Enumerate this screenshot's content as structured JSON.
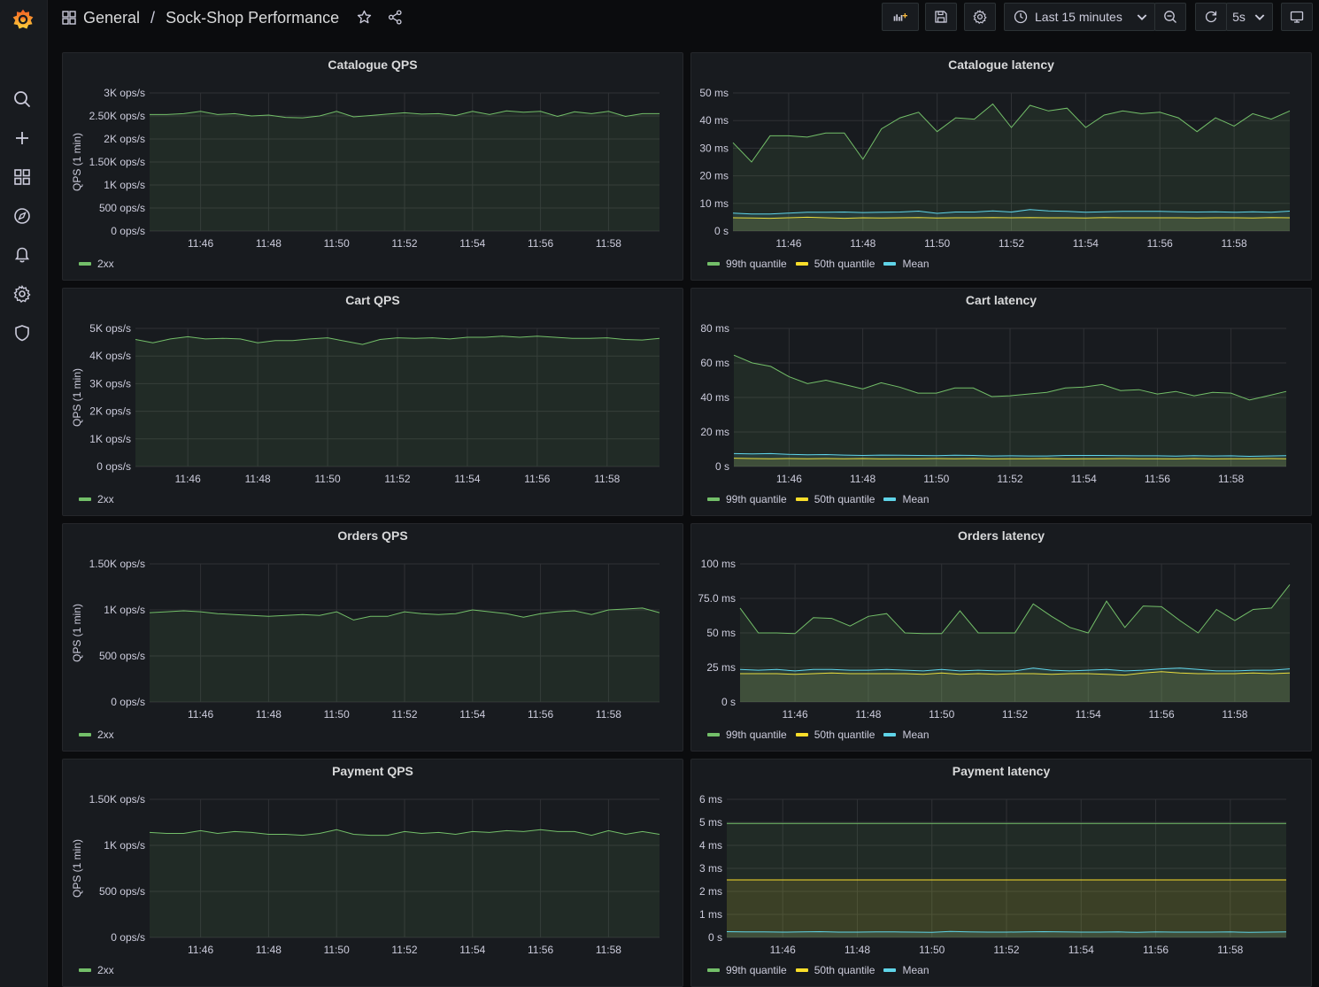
{
  "breadcrumb": {
    "folder": "General",
    "separator": "/",
    "dashboard": "Sock-Shop Performance"
  },
  "toolbar": {
    "time_range": "Last 15 minutes",
    "refresh_interval": "5s"
  },
  "icons": {
    "logo": "grafana-logo-icon",
    "sidebar": [
      "search-icon",
      "plus-icon",
      "dashboards-icon",
      "explore-icon",
      "alerting-icon",
      "configuration-icon",
      "shield-icon"
    ],
    "topbar": [
      "apps-icon",
      "star-icon",
      "share-icon",
      "add-panel-icon",
      "save-icon",
      "settings-icon",
      "clock-icon",
      "chevron-down-icon",
      "zoom-out-icon",
      "refresh-icon",
      "tv-icon"
    ]
  },
  "colors": {
    "green": "#73bf69",
    "yellow": "#fade2a",
    "blue": "#5794f2",
    "cyan": "#8ab8ff",
    "mean": "#5fd4e8"
  },
  "time_ticks": [
    "11:46",
    "11:48",
    "11:50",
    "11:52",
    "11:54",
    "11:56",
    "11:58"
  ],
  "panels": [
    {
      "id": "catalogue-qps",
      "title": "Catalogue QPS",
      "ylabel": "QPS (1 min)",
      "yticks": [
        "0 ops/s",
        "500 ops/s",
        "1K ops/s",
        "1.50K ops/s",
        "2K ops/s",
        "2.50K ops/s",
        "3K ops/s"
      ],
      "legend": [
        "2xx"
      ]
    },
    {
      "id": "catalogue-latency",
      "title": "Catalogue latency",
      "ylabel": "",
      "yticks": [
        "0 s",
        "10 ms",
        "20 ms",
        "30 ms",
        "40 ms",
        "50 ms"
      ],
      "legend": [
        "99th quantile",
        "50th quantile",
        "Mean"
      ]
    },
    {
      "id": "cart-qps",
      "title": "Cart QPS",
      "ylabel": "QPS (1 min)",
      "yticks": [
        "0 ops/s",
        "1K ops/s",
        "2K ops/s",
        "3K ops/s",
        "4K ops/s",
        "5K ops/s"
      ],
      "legend": [
        "2xx"
      ]
    },
    {
      "id": "cart-latency",
      "title": "Cart latency",
      "ylabel": "",
      "yticks": [
        "0 s",
        "20 ms",
        "40 ms",
        "60 ms",
        "80 ms"
      ],
      "legend": [
        "99th quantile",
        "50th quantile",
        "Mean"
      ]
    },
    {
      "id": "orders-qps",
      "title": "Orders QPS",
      "ylabel": "QPS (1 min)",
      "yticks": [
        "0 ops/s",
        "500 ops/s",
        "1K ops/s",
        "1.50K ops/s"
      ],
      "legend": [
        "2xx"
      ]
    },
    {
      "id": "orders-latency",
      "title": "Orders latency",
      "ylabel": "",
      "yticks": [
        "0 s",
        "25 ms",
        "50 ms",
        "75.0 ms",
        "100 ms"
      ],
      "legend": [
        "99th quantile",
        "50th quantile",
        "Mean"
      ]
    },
    {
      "id": "payment-qps",
      "title": "Payment QPS",
      "ylabel": "QPS (1 min)",
      "yticks": [
        "0 ops/s",
        "500 ops/s",
        "1K ops/s",
        "1.50K ops/s"
      ],
      "legend": [
        "2xx"
      ]
    },
    {
      "id": "payment-latency",
      "title": "Payment latency",
      "ylabel": "",
      "yticks": [
        "0 s",
        "1 ms",
        "2 ms",
        "3 ms",
        "4 ms",
        "5 ms",
        "6 ms"
      ],
      "legend": [
        "99th quantile",
        "50th quantile",
        "Mean"
      ]
    }
  ],
  "chart_data": [
    {
      "type": "area",
      "title": "Catalogue QPS",
      "ylabel": "QPS (1 min)",
      "ylim": [
        0,
        3000
      ],
      "unit": "ops/s",
      "x": [
        "11:45",
        "11:45:30",
        "11:46",
        "11:46:30",
        "11:47",
        "11:47:30",
        "11:48",
        "11:48:30",
        "11:49",
        "11:49:30",
        "11:50",
        "11:50:30",
        "11:51",
        "11:51:30",
        "11:52",
        "11:52:30",
        "11:53",
        "11:53:30",
        "11:54",
        "11:54:30",
        "11:55",
        "11:55:30",
        "11:56",
        "11:56:30",
        "11:57",
        "11:57:30",
        "11:58",
        "11:58:30",
        "11:59",
        "11:59:30"
      ],
      "series": [
        {
          "name": "2xx",
          "color": "#73bf69",
          "values": [
            2530,
            2530,
            2550,
            2600,
            2530,
            2550,
            2500,
            2520,
            2470,
            2460,
            2500,
            2600,
            2480,
            2510,
            2540,
            2570,
            2540,
            2550,
            2510,
            2600,
            2530,
            2610,
            2580,
            2600,
            2490,
            2590,
            2550,
            2600,
            2490,
            2550,
            2550
          ]
        }
      ]
    },
    {
      "type": "area",
      "title": "Catalogue latency",
      "ylim": [
        0,
        50
      ],
      "unit": "ms",
      "series": [
        {
          "name": "99th quantile",
          "color": "#73bf69",
          "values": [
            32,
            25,
            34.5,
            34.5,
            34,
            35.5,
            35.5,
            26,
            37,
            41,
            43,
            36,
            41,
            40.5,
            46,
            37.5,
            45.5,
            43.5,
            44.5,
            37.5,
            42,
            43.5,
            42.5,
            43,
            41,
            36,
            41,
            38,
            42.5,
            40.5,
            43.5
          ]
        },
        {
          "name": "50th quantile",
          "color": "#fade2a",
          "values": [
            4.8,
            4.7,
            4.6,
            4.8,
            5,
            4.8,
            4.6,
            4.8,
            4.7,
            4.8,
            4.9,
            4.7,
            4.8,
            4.8,
            4.9,
            4.8,
            4.9,
            4.8,
            4.8,
            4.7,
            4.9,
            4.8,
            4.8,
            4.8,
            4.8,
            4.7,
            4.8,
            4.8,
            4.7,
            4.9,
            4.8
          ]
        },
        {
          "name": "Mean",
          "color": "#5fd4e8",
          "values": [
            6.5,
            6.2,
            6.2,
            6.5,
            6.8,
            6.8,
            6.9,
            6.7,
            6.8,
            6.9,
            7.2,
            6.4,
            6.9,
            6.9,
            7.3,
            6.9,
            7.8,
            7.3,
            7.1,
            6.8,
            7.0,
            7.1,
            7.1,
            7.1,
            7.0,
            6.9,
            7.0,
            6.8,
            7.0,
            6.8,
            7.2
          ]
        }
      ]
    },
    {
      "type": "area",
      "title": "Cart QPS",
      "ylabel": "QPS (1 min)",
      "ylim": [
        0,
        5000
      ],
      "unit": "ops/s",
      "series": [
        {
          "name": "2xx",
          "color": "#73bf69",
          "values": [
            4600,
            4480,
            4620,
            4700,
            4620,
            4640,
            4620,
            4480,
            4560,
            4560,
            4620,
            4660,
            4540,
            4420,
            4600,
            4660,
            4640,
            4660,
            4620,
            4680,
            4680,
            4720,
            4680,
            4720,
            4680,
            4640,
            4640,
            4660,
            4600,
            4580,
            4640
          ]
        }
      ]
    },
    {
      "type": "area",
      "title": "Cart latency",
      "ylim": [
        0,
        80
      ],
      "unit": "ms",
      "series": [
        {
          "name": "99th quantile",
          "color": "#73bf69",
          "values": [
            64.5,
            60,
            58,
            52,
            48,
            50,
            47.5,
            45,
            48.5,
            46,
            42.5,
            42.5,
            45.5,
            45.5,
            40.5,
            41,
            42,
            43,
            45.5,
            46,
            47.5,
            44,
            44.5,
            42,
            43.5,
            41,
            43,
            42.5,
            38.5,
            41,
            43.5
          ]
        },
        {
          "name": "50th quantile",
          "color": "#fade2a",
          "values": [
            4.8,
            4.6,
            4.5,
            4.6,
            4.5,
            4.6,
            4.5,
            4.6,
            4.4,
            4.5,
            4.5,
            4.6,
            4.5,
            4.6,
            4.4,
            4.5,
            4.5,
            4.6,
            4.4,
            4.5,
            4.5,
            4.6,
            4.5,
            4.5,
            4.4,
            4.6,
            4.4,
            4.5,
            4.5,
            4.6,
            4.5
          ]
        },
        {
          "name": "Mean",
          "color": "#5fd4e8",
          "values": [
            7.5,
            7.3,
            7.5,
            7.0,
            6.8,
            6.9,
            6.6,
            6.4,
            6.6,
            6.5,
            6.4,
            6.3,
            6.5,
            6.4,
            6.1,
            6.2,
            6.1,
            6.1,
            6.4,
            6.4,
            6.4,
            6.3,
            6.2,
            6.2,
            6.0,
            6.3,
            6.1,
            6.2,
            5.9,
            6.1,
            6.3
          ]
        }
      ]
    },
    {
      "type": "area",
      "title": "Orders QPS",
      "ylabel": "QPS (1 min)",
      "ylim": [
        0,
        1500
      ],
      "unit": "ops/s",
      "series": [
        {
          "name": "2xx",
          "color": "#73bf69",
          "values": [
            970,
            980,
            990,
            980,
            960,
            950,
            940,
            930,
            940,
            950,
            940,
            980,
            890,
            930,
            930,
            980,
            960,
            950,
            960,
            1000,
            980,
            960,
            920,
            960,
            980,
            990,
            950,
            1000,
            1010,
            1020,
            970
          ]
        }
      ]
    },
    {
      "type": "area",
      "title": "Orders latency",
      "ylim": [
        0,
        100
      ],
      "unit": "ms",
      "series": [
        {
          "name": "99th quantile",
          "color": "#73bf69",
          "values": [
            68,
            50,
            50,
            49.5,
            61,
            60.5,
            55,
            62,
            64,
            50,
            49.5,
            49.5,
            66,
            50,
            50,
            50,
            71,
            62,
            54,
            50,
            73,
            54,
            69.5,
            69,
            59,
            50,
            67,
            59,
            67,
            68,
            85
          ]
        },
        {
          "name": "50th quantile",
          "color": "#fade2a",
          "values": [
            20.5,
            20.5,
            20.5,
            20,
            20.5,
            21,
            20.5,
            20.5,
            20.5,
            20.5,
            20,
            21,
            20,
            20.5,
            20,
            20.5,
            20.5,
            20,
            20.5,
            20.5,
            20,
            19.5,
            21,
            22,
            21,
            20.5,
            20.5,
            20.5,
            21,
            20.5,
            21
          ]
        },
        {
          "name": "Mean",
          "color": "#5fd4e8",
          "values": [
            23.5,
            23,
            23.5,
            22.5,
            23.5,
            23.5,
            23,
            23,
            23.5,
            23,
            22.5,
            23.5,
            22.5,
            23,
            22.5,
            22.5,
            24.5,
            23,
            22.5,
            23,
            23.5,
            22.5,
            23,
            24,
            24.5,
            23.5,
            22.5,
            22.5,
            23,
            23,
            24
          ]
        }
      ]
    },
    {
      "type": "area",
      "title": "Payment QPS",
      "ylabel": "QPS (1 min)",
      "ylim": [
        0,
        1500
      ],
      "unit": "ops/s",
      "series": [
        {
          "name": "2xx",
          "color": "#73bf69",
          "values": [
            1140,
            1130,
            1130,
            1160,
            1130,
            1150,
            1140,
            1120,
            1120,
            1110,
            1130,
            1170,
            1120,
            1110,
            1110,
            1150,
            1130,
            1140,
            1120,
            1150,
            1140,
            1160,
            1150,
            1170,
            1150,
            1150,
            1110,
            1160,
            1120,
            1150,
            1120
          ]
        }
      ]
    },
    {
      "type": "area",
      "title": "Payment latency",
      "ylim": [
        0,
        6
      ],
      "unit": "ms",
      "series": [
        {
          "name": "99th quantile",
          "color": "#73bf69",
          "values": [
            4.95,
            4.95,
            4.95,
            4.95,
            4.95,
            4.95,
            4.95,
            4.95,
            4.95,
            4.95,
            4.95,
            4.95,
            4.95,
            4.95,
            4.95,
            4.95,
            4.95,
            4.95,
            4.95,
            4.95,
            4.95,
            4.95,
            4.95,
            4.95,
            4.95,
            4.95,
            4.95,
            4.95,
            4.95,
            4.95,
            4.95
          ]
        },
        {
          "name": "50th quantile",
          "color": "#fade2a",
          "values": [
            2.5,
            2.5,
            2.5,
            2.5,
            2.5,
            2.5,
            2.5,
            2.5,
            2.5,
            2.5,
            2.5,
            2.5,
            2.5,
            2.5,
            2.5,
            2.5,
            2.5,
            2.5,
            2.5,
            2.5,
            2.5,
            2.5,
            2.5,
            2.5,
            2.5,
            2.5,
            2.5,
            2.5,
            2.5,
            2.5,
            2.5
          ]
        },
        {
          "name": "Mean",
          "color": "#5fd4e8",
          "values": [
            0.25,
            0.24,
            0.24,
            0.23,
            0.24,
            0.25,
            0.23,
            0.23,
            0.24,
            0.24,
            0.23,
            0.22,
            0.26,
            0.24,
            0.23,
            0.23,
            0.24,
            0.25,
            0.24,
            0.23,
            0.23,
            0.24,
            0.22,
            0.24,
            0.23,
            0.23,
            0.23,
            0.24,
            0.22,
            0.23,
            0.24
          ]
        }
      ]
    }
  ]
}
